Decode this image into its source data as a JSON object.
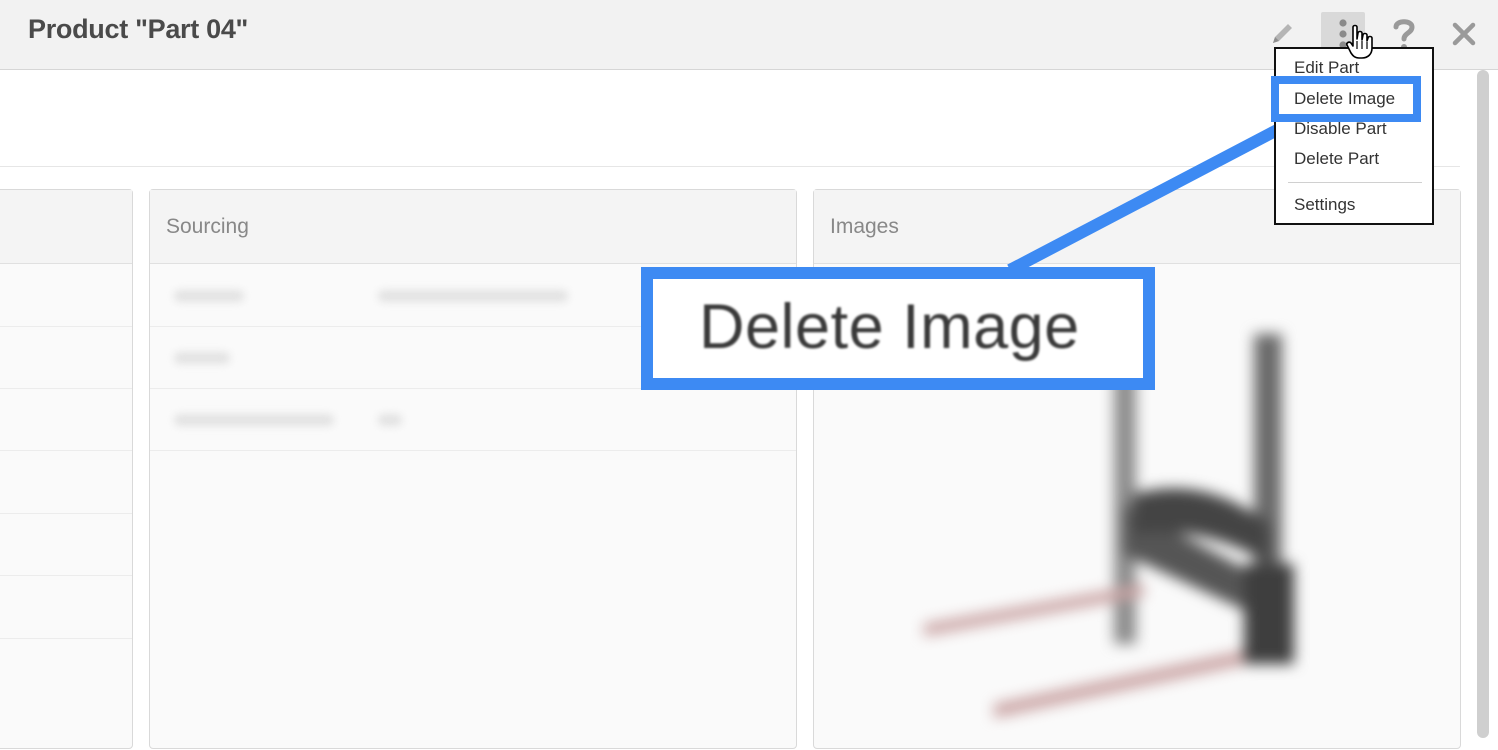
{
  "header": {
    "title": "Product \"Part 04\"",
    "icons": [
      "pencil-icon",
      "more-vertical-icon",
      "help-icon",
      "close-icon"
    ]
  },
  "menu": {
    "items": [
      {
        "label": "Edit Part"
      },
      {
        "label": "Delete Image"
      },
      {
        "label": "Disable Part"
      },
      {
        "label": "Delete Part"
      },
      {
        "label": "Settings"
      }
    ]
  },
  "panels": {
    "sourcing": {
      "title": "Sourcing"
    },
    "images": {
      "title": "Images"
    }
  },
  "callout": {
    "text": "Delete Image",
    "color": "#3d8af3"
  }
}
